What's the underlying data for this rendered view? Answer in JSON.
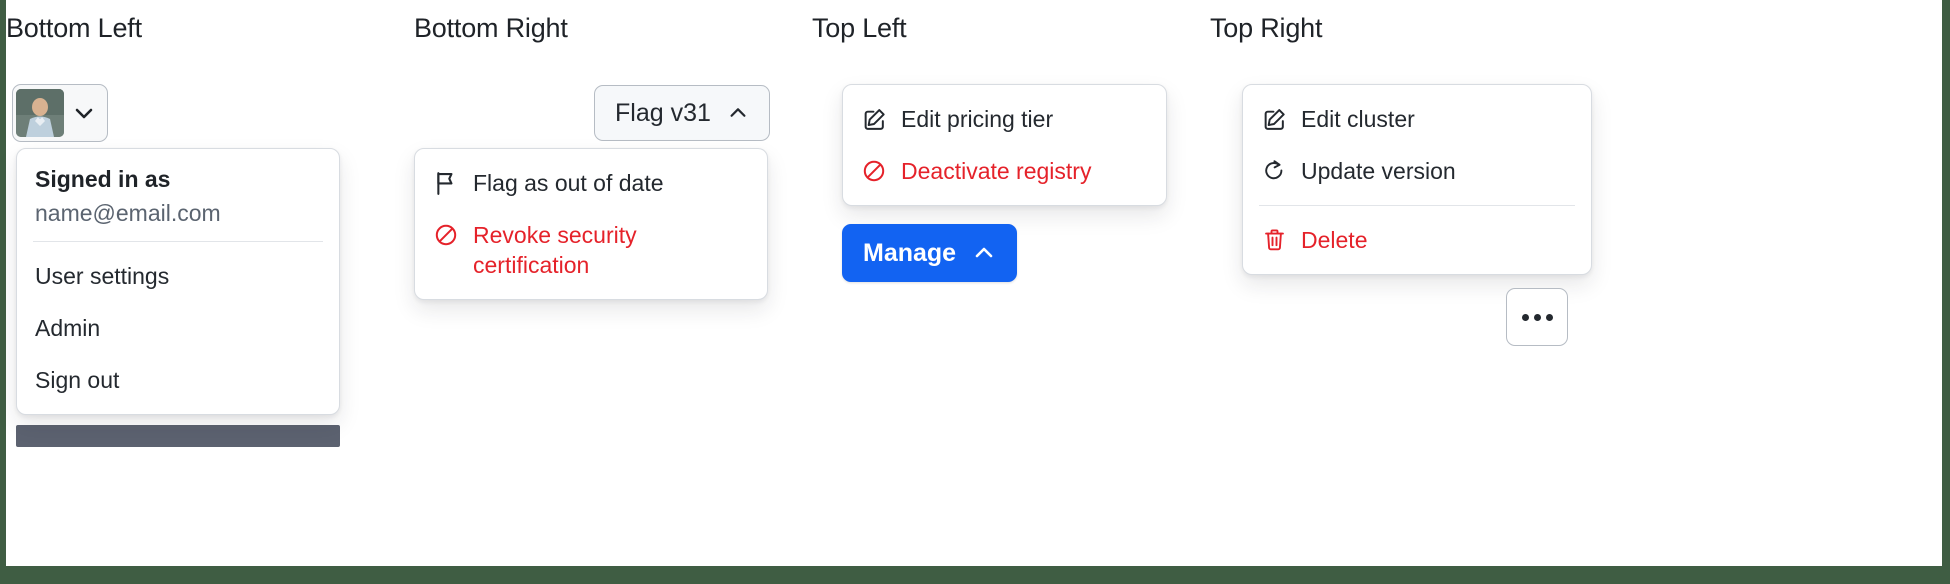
{
  "columns": [
    {
      "title": "Bottom Left",
      "trigger": {
        "type": "avatar-split-button",
        "caret_icon": "chevron-down-icon",
        "avatar_icon": "user-avatar-photo"
      },
      "menu": {
        "header_title": "Signed in as",
        "header_email": "name@email.com",
        "items": [
          {
            "label": "User settings",
            "icon": "",
            "danger": false
          },
          {
            "label": "Admin",
            "icon": "",
            "danger": false
          },
          {
            "label": "Sign out",
            "icon": "",
            "danger": false
          }
        ]
      }
    },
    {
      "title": "Bottom Right",
      "trigger": {
        "type": "button",
        "label": "Flag v31",
        "caret_icon": "chevron-up-icon"
      },
      "menu": {
        "items": [
          {
            "label": "Flag as out of date",
            "icon": "flag-icon",
            "danger": false
          },
          {
            "label": "Revoke security certification",
            "icon": "block-icon",
            "danger": true
          }
        ]
      }
    },
    {
      "title": "Top Left",
      "trigger": {
        "type": "button-primary",
        "label": "Manage",
        "caret_icon": "chevron-up-icon"
      },
      "menu": {
        "items": [
          {
            "label": "Edit pricing tier",
            "icon": "pencil-square-icon",
            "danger": false
          },
          {
            "label": "Deactivate registry",
            "icon": "block-icon",
            "danger": true
          }
        ]
      }
    },
    {
      "title": "Top Right",
      "trigger": {
        "type": "icon-button",
        "label": "",
        "icon": "kebab-horizontal-icon"
      },
      "menu": {
        "items": [
          {
            "label": "Edit cluster",
            "icon": "pencil-square-icon",
            "danger": false
          },
          {
            "label": "Update version",
            "icon": "sync-icon",
            "danger": false
          },
          {
            "label": "Delete",
            "icon": "trash-icon",
            "danger": true
          }
        ]
      }
    }
  ],
  "colors": {
    "danger": "#e5222a",
    "primary": "#1263f2",
    "text": "#24292f",
    "muted": "#5b6470",
    "border": "#d8dce1",
    "page_edge": "#3f5d43",
    "overflow_bar": "#5c6270"
  }
}
